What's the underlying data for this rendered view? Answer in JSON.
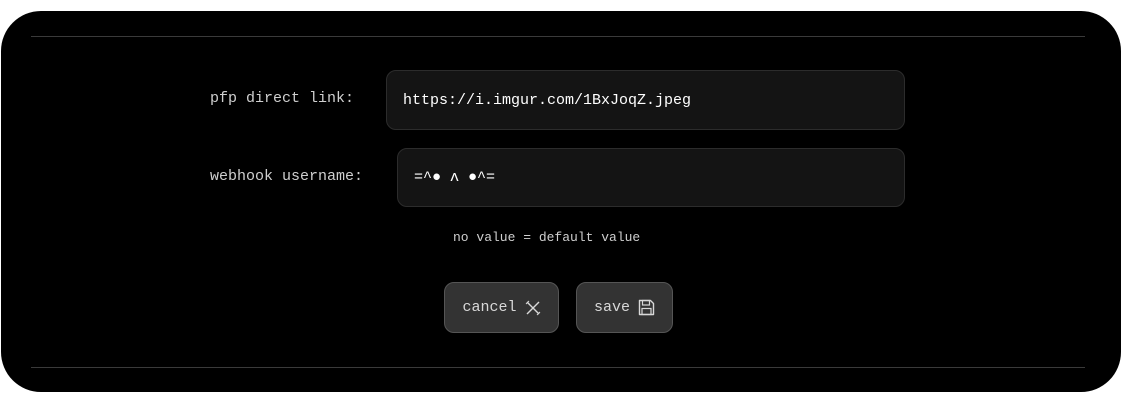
{
  "form": {
    "pfp": {
      "label": "pfp direct link:",
      "value": "https://i.imgur.com/1BxJoqZ.jpeg"
    },
    "username": {
      "label": "webhook username:",
      "value": "=^● ʌ ●^="
    },
    "hint": "no value = default value"
  },
  "buttons": {
    "cancel": {
      "label": "cancel",
      "icon": "close-icon"
    },
    "save": {
      "label": "save",
      "icon": "floppy-disk-icon"
    }
  },
  "colors": {
    "panel_background": "#000000",
    "field_background": "#141414",
    "button_background": "#333333",
    "text": "#cfcfcf"
  }
}
